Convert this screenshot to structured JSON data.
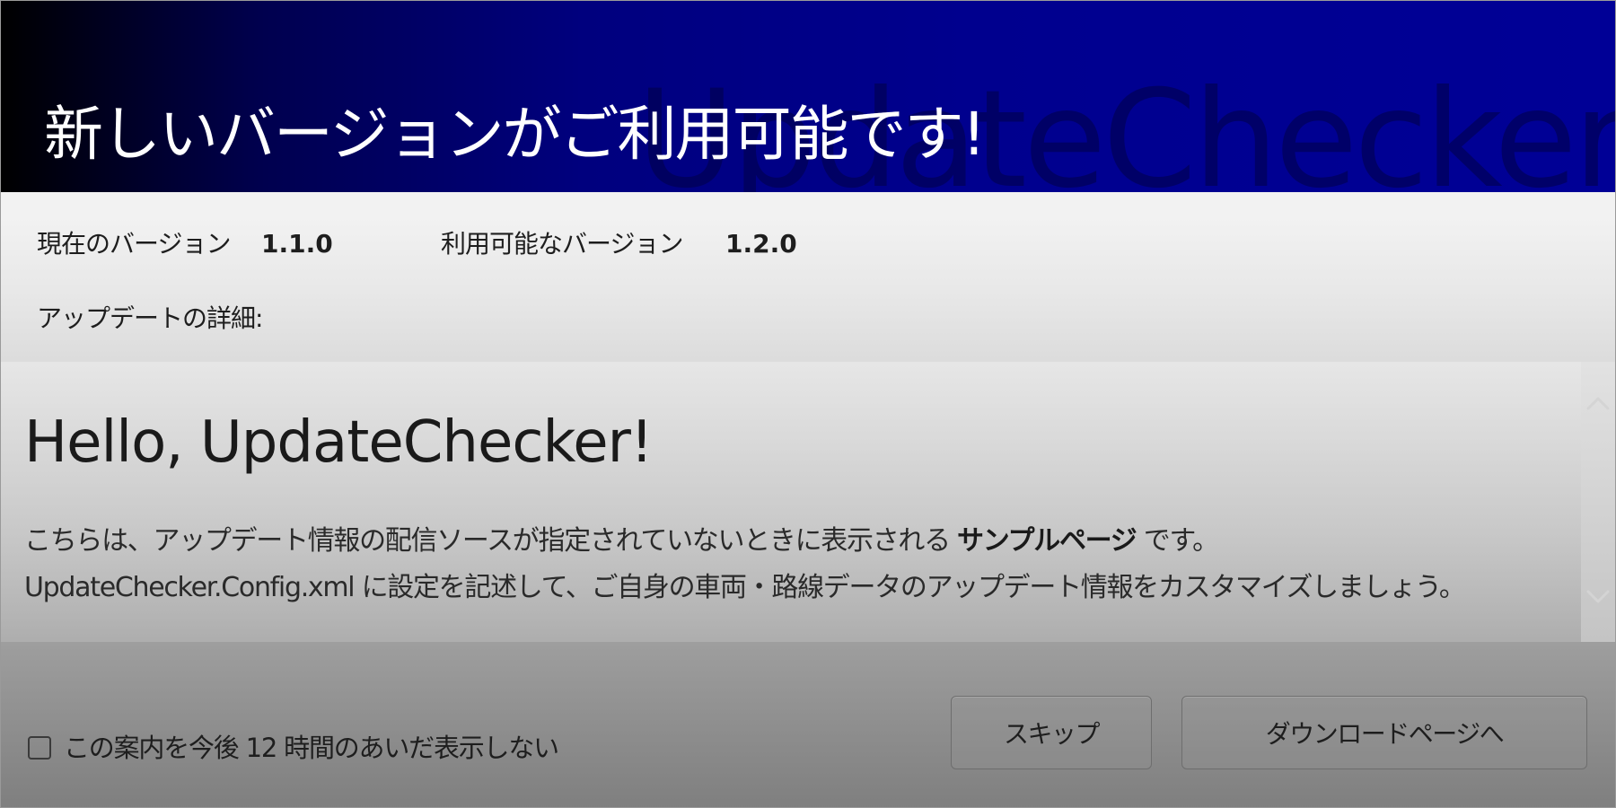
{
  "header": {
    "title": "新しいバージョンがご利用可能です!",
    "watermark": "UpdateChecker"
  },
  "versions": {
    "current_label": "現在のバージョン",
    "current_value": "1.1.0",
    "available_label": "利用可能なバージョン",
    "available_value": "1.2.0"
  },
  "details": {
    "label": "アップデートの詳細:",
    "heading": "Hello, UpdateChecker!",
    "line1_prefix": "こちらは、アップデート情報の配信ソースが指定されていないときに表示される ",
    "line1_bold": "サンプルページ",
    "line1_suffix": " です。",
    "line2": "UpdateChecker.Config.xml に設定を記述して、ご自身の車両・路線データのアップデート情報をカスタマイズしましょう。"
  },
  "scrollbar": {
    "up_icon": "chevron-up-icon",
    "down_icon": "chevron-down-icon"
  },
  "footer": {
    "suppress_checkbox_label": "この案内を今後 12 時間のあいだ表示しない",
    "suppress_checked": false,
    "skip_button": "スキップ",
    "download_button": "ダウンロードページへ"
  },
  "colors": {
    "header_gradient_start": "#000000",
    "header_gradient_end": "#000096",
    "title_text": "#ffffff"
  }
}
